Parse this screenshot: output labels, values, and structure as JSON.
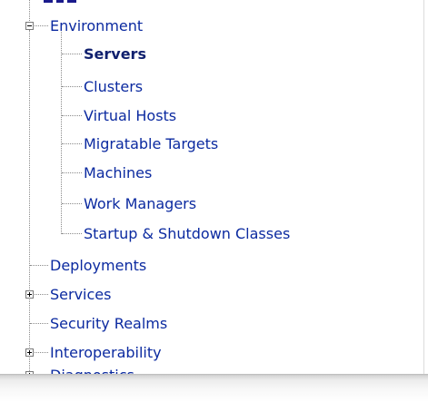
{
  "tree": {
    "environment": {
      "label": "Environment",
      "toggle_icon": "minus-box-icon",
      "children": [
        {
          "label": "Servers",
          "selected": true
        },
        {
          "label": "Clusters"
        },
        {
          "label": "Virtual Hosts"
        },
        {
          "label": "Migratable Targets"
        },
        {
          "label": "Machines"
        },
        {
          "label": "Work Managers"
        },
        {
          "label": "Startup & Shutdown Classes"
        }
      ]
    },
    "deployments": {
      "label": "Deployments"
    },
    "services": {
      "label": "Services",
      "toggle_icon": "plus-box-icon"
    },
    "security_realms": {
      "label": "Security Realms"
    },
    "interoperability": {
      "label": "Interoperability",
      "toggle_icon": "plus-box-icon"
    },
    "diagnostics": {
      "label": "Diagnostics",
      "toggle_icon": "plus-box-icon"
    }
  },
  "colors": {
    "link": "#0b2aa0",
    "selected": "#10206e",
    "connector": "#8a8a8a"
  }
}
